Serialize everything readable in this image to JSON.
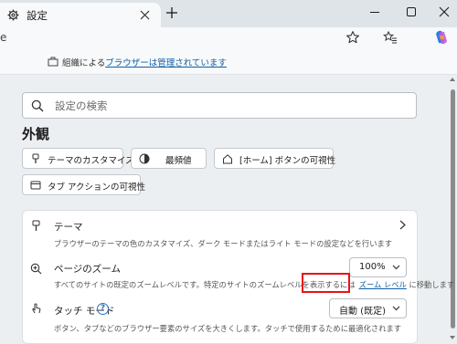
{
  "tab": {
    "title": "設定"
  },
  "address": {
    "text": "e"
  },
  "managed": {
    "prefix": "組織による",
    "link": "ブラウザーは管理されています"
  },
  "search": {
    "placeholder": "設定の検索"
  },
  "section": {
    "title": "外観"
  },
  "quick_buttons": [
    {
      "label": "テーマのカスタマイズ"
    },
    {
      "label": "最頻値"
    },
    {
      "label": "[ホーム] ボタンの可視性"
    },
    {
      "label": "タブ アクションの可視性"
    }
  ],
  "rows": {
    "theme": {
      "title": "テーマ",
      "desc": "ブラウザーのテーマの色のカスタマイズ、ダーク モードまたはライト モードの設定などを行います"
    },
    "zoom": {
      "title": "ページのズーム",
      "desc_before": "すべてのサイトの既定のズームレベルです。特定のサイトのズームレベルを表示するには",
      "link": "ズーム レベル",
      "desc_after": " に移動します",
      "value": "100%"
    },
    "touch": {
      "title": "タッチ モード",
      "desc": "ボタン、タブなどのブラウザー要素のサイズを大きくします。タッチで使用するために最適化されます",
      "value": "自動 (既定)"
    }
  },
  "colors": {
    "accent": "#115ea3",
    "highlight": "#e8121a"
  }
}
